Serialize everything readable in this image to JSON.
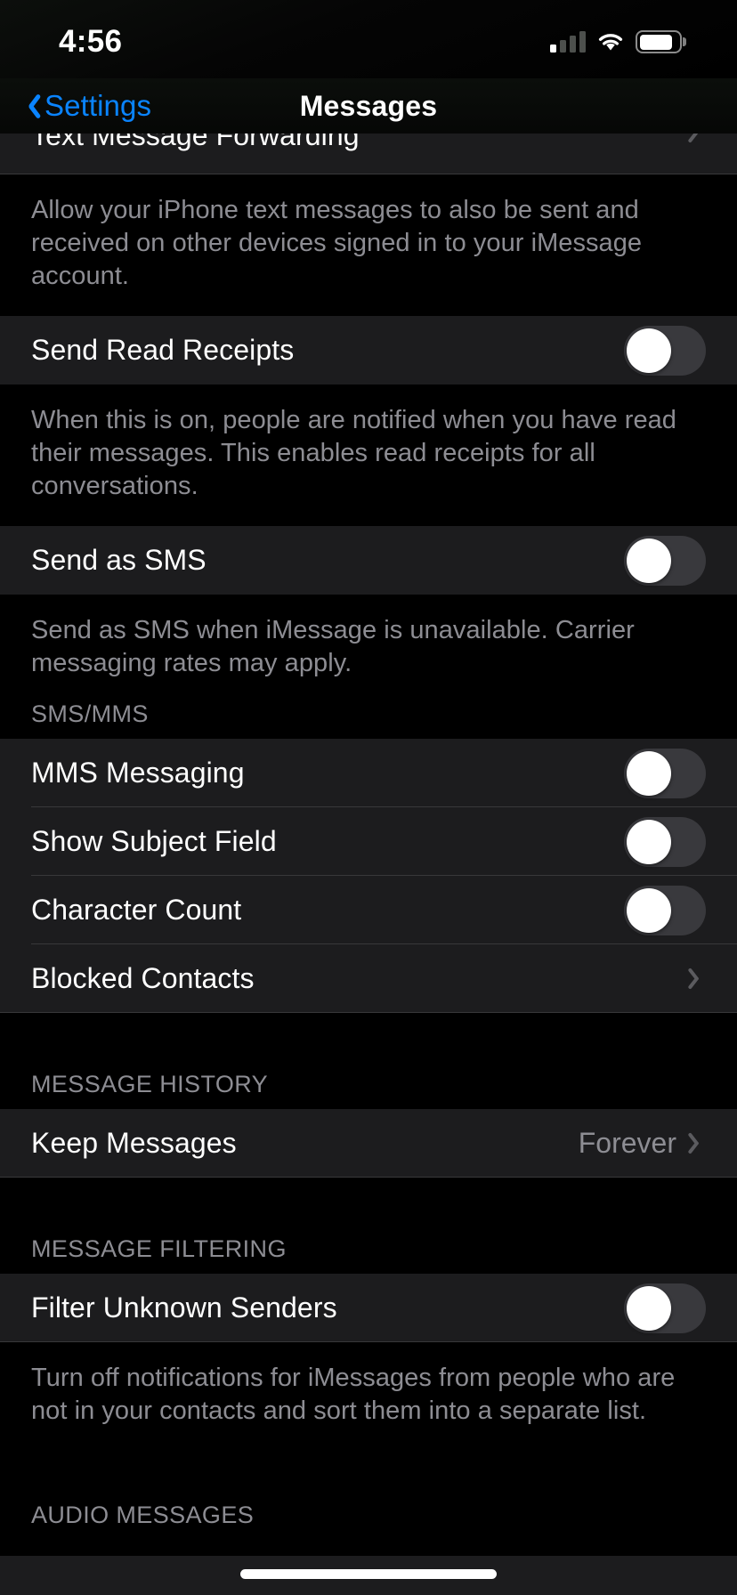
{
  "status_bar": {
    "time": "4:56",
    "signal_icon": "cellular-signal-icon",
    "signal_bars_active": 1,
    "signal_bars_total": 4,
    "wifi_icon": "wifi-icon",
    "battery_icon": "battery-icon",
    "battery_level_percent": 85
  },
  "nav": {
    "back_label": "Settings",
    "back_icon": "chevron-left-icon",
    "title": "Messages"
  },
  "sections": [
    {
      "rows": [
        {
          "label": "Text Message Forwarding",
          "type": "disclosure",
          "clipped": true
        }
      ],
      "footer": "Allow your iPhone text messages to also be sent and received on other devices signed in to your iMessage account."
    },
    {
      "rows": [
        {
          "label": "Send Read Receipts",
          "type": "toggle",
          "on": false
        }
      ],
      "footer": "When this is on, people are notified when you have read their messages. This enables read receipts for all conversations."
    },
    {
      "rows": [
        {
          "label": "Send as SMS",
          "type": "toggle",
          "on": false
        }
      ],
      "footer": "Send as SMS when iMessage is unavailable. Carrier messaging rates may apply."
    },
    {
      "header": "SMS/MMS",
      "rows": [
        {
          "label": "MMS Messaging",
          "type": "toggle",
          "on": false
        },
        {
          "label": "Show Subject Field",
          "type": "toggle",
          "on": false
        },
        {
          "label": "Character Count",
          "type": "toggle",
          "on": false
        },
        {
          "label": "Blocked Contacts",
          "type": "disclosure"
        }
      ]
    },
    {
      "header": "MESSAGE HISTORY",
      "rows": [
        {
          "label": "Keep Messages",
          "type": "disclosure",
          "value": "Forever"
        }
      ]
    },
    {
      "header": "MESSAGE FILTERING",
      "rows": [
        {
          "label": "Filter Unknown Senders",
          "type": "toggle",
          "on": false
        }
      ],
      "footer": "Turn off notifications for iMessages from people who are not in your contacts and sort them into a separate list."
    },
    {
      "header": "AUDIO MESSAGES",
      "rows": []
    }
  ],
  "colors": {
    "accent_blue": "#0A84FF",
    "card_background": "#1C1C1E",
    "page_background": "#000000",
    "secondary_text": "#8D8D93",
    "separator": "#38383A",
    "toggle_off_track": "#39393D",
    "toggle_on_track": "#34C759"
  }
}
